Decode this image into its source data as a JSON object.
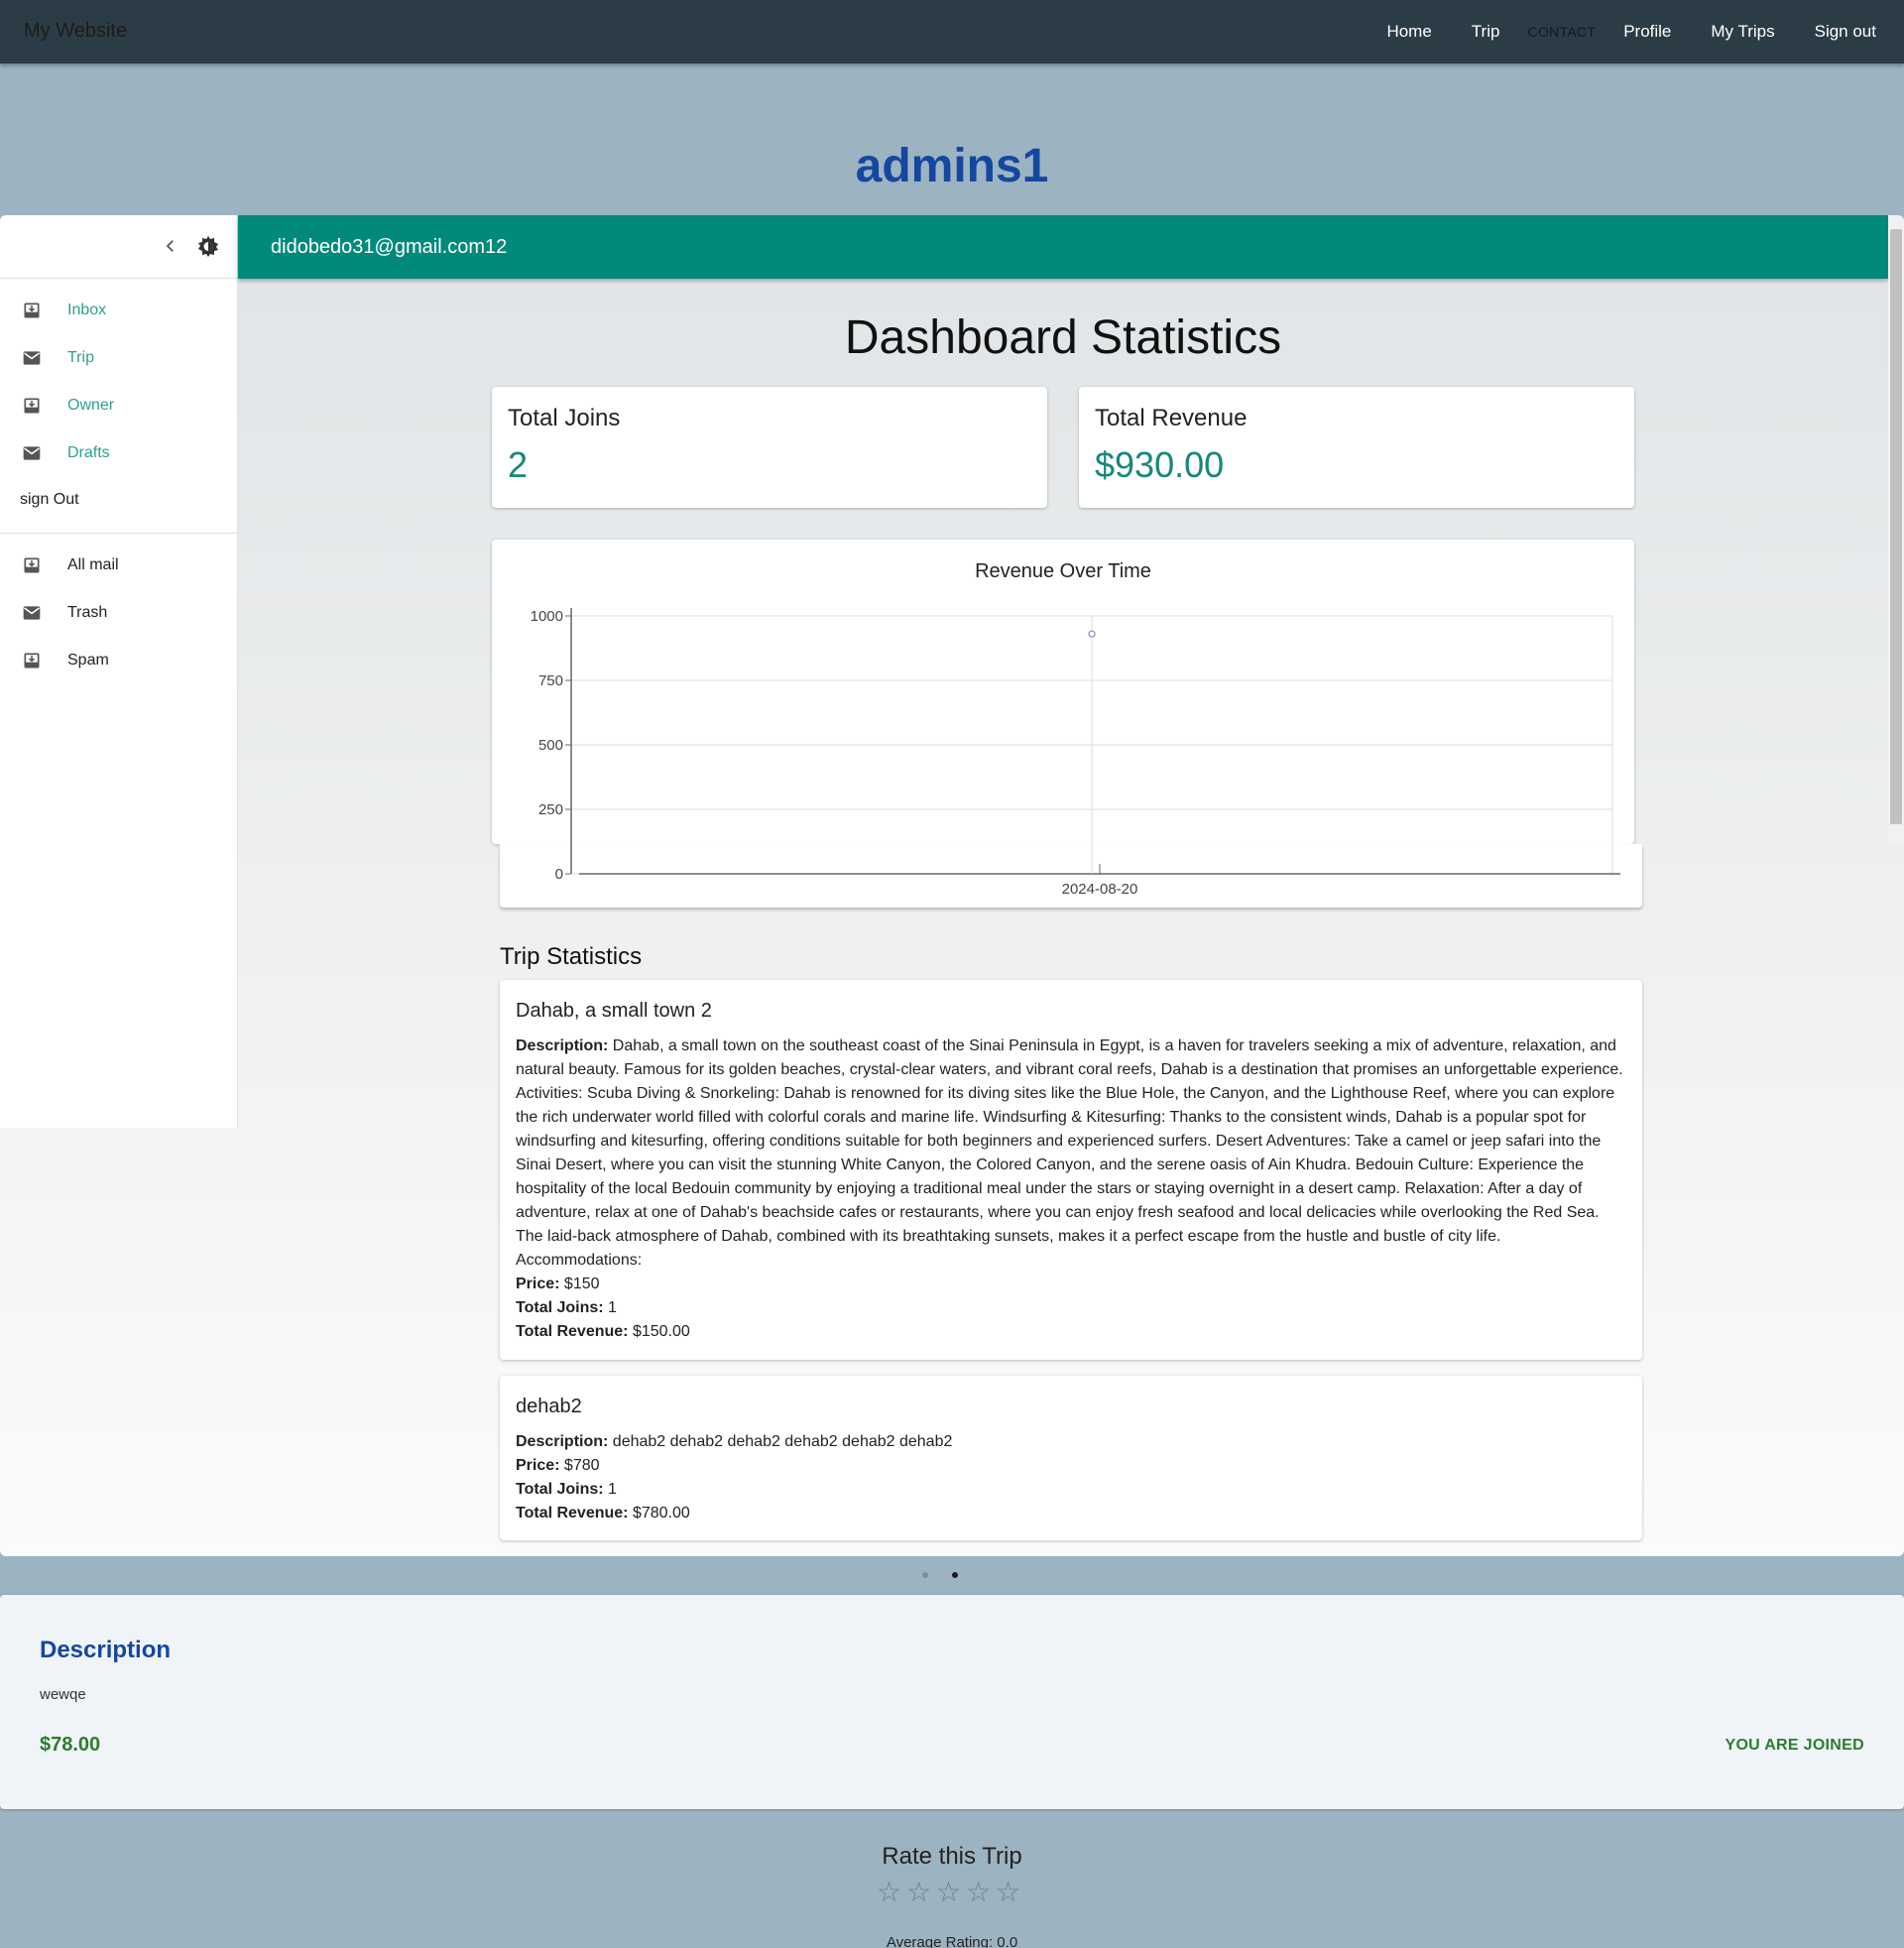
{
  "nav": {
    "brand": "My Website",
    "links": [
      "Home",
      "Trip",
      "CONTACT",
      "Profile",
      "My Trips",
      "Sign out"
    ]
  },
  "page_title": "admins1",
  "appbar_title": "didobedo31@gmail.com12",
  "drawer": {
    "primary": [
      {
        "label": "Inbox",
        "icon": "inbox-icon"
      },
      {
        "label": "Trip",
        "icon": "mail-icon"
      },
      {
        "label": "Owner",
        "icon": "inbox-icon"
      },
      {
        "label": "Drafts",
        "icon": "mail-icon"
      }
    ],
    "sign_out": "sign Out",
    "secondary": [
      {
        "label": "All mail",
        "icon": "inbox-icon"
      },
      {
        "label": "Trash",
        "icon": "mail-icon"
      },
      {
        "label": "Spam",
        "icon": "inbox-icon"
      }
    ]
  },
  "dashboard": {
    "title": "Dashboard Statistics",
    "total_joins_label": "Total Joins",
    "total_joins_value": "2",
    "total_revenue_label": "Total Revenue",
    "total_revenue_value": "$930.00"
  },
  "chart_data": {
    "type": "line",
    "title": "Revenue Over Time",
    "xlabel": "",
    "ylabel": "",
    "categories": [
      "2024-08-20"
    ],
    "series": [
      {
        "values": [
          930
        ]
      }
    ],
    "ylim": [
      0,
      1000
    ],
    "yticks": [
      0,
      250,
      500,
      750,
      1000
    ],
    "grid": true,
    "colors": {
      "point": "#8a8ac8",
      "grid": "#dddddd",
      "axis": "#666666"
    }
  },
  "trip_stats": {
    "heading": "Trip Statistics",
    "labels": {
      "description": "Description:",
      "price": "Price:",
      "joins": "Total Joins:",
      "revenue": "Total Revenue:"
    },
    "trips": [
      {
        "name": "Dahab, a small town 2",
        "description": "Dahab, a small town on the southeast coast of the Sinai Peninsula in Egypt, is a haven for travelers seeking a mix of adventure, relaxation, and natural beauty. Famous for its golden beaches, crystal-clear waters, and vibrant coral reefs, Dahab is a destination that promises an unforgettable experience. Activities: Scuba Diving & Snorkeling: Dahab is renowned for its diving sites like the Blue Hole, the Canyon, and the Lighthouse Reef, where you can explore the rich underwater world filled with colorful corals and marine life. Windsurfing & Kitesurfing: Thanks to the consistent winds, Dahab is a popular spot for windsurfing and kitesurfing, offering conditions suitable for both beginners and experienced surfers. Desert Adventures: Take a camel or jeep safari into the Sinai Desert, where you can visit the stunning White Canyon, the Colored Canyon, and the serene oasis of Ain Khudra. Bedouin Culture: Experience the hospitality of the local Bedouin community by enjoying a traditional meal under the stars or staying overnight in a desert camp. Relaxation: After a day of adventure, relax at one of Dahab's beachside cafes or restaurants, where you can enjoy fresh seafood and local delicacies while overlooking the Red Sea. The laid-back atmosphere of Dahab, combined with its breathtaking sunsets, makes it a perfect escape from the hustle and bustle of city life. Accommodations:",
        "price": "$150",
        "joins": "1",
        "revenue": "$150.00"
      },
      {
        "name": "dehab2",
        "description": "dehab2 dehab2 dehab2 dehab2 dehab2 dehab2",
        "price": "$780",
        "joins": "1",
        "revenue": "$780.00"
      }
    ]
  },
  "carousel": {
    "slide_count": 2,
    "active_index": 1
  },
  "trip_detail": {
    "heading": "Description",
    "text": "wewqe",
    "price": "$78.00",
    "status": "YOU ARE JOINED"
  },
  "rating": {
    "title": "Rate this Trip",
    "stars_total": 5,
    "stars_filled": 0,
    "average_label": "Average Rating: 0.0"
  }
}
